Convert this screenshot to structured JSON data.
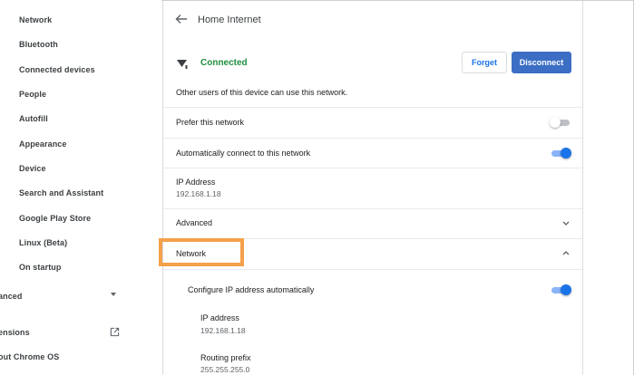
{
  "sidebar": {
    "items": [
      {
        "label": "Network"
      },
      {
        "label": "Bluetooth"
      },
      {
        "label": "Connected devices"
      },
      {
        "label": "People"
      },
      {
        "label": "Autofill"
      },
      {
        "label": "Appearance"
      },
      {
        "label": "Device"
      },
      {
        "label": "Search and Assistant"
      },
      {
        "label": "Google Play Store"
      },
      {
        "label": "Linux (Beta)"
      },
      {
        "label": "On startup"
      }
    ],
    "advanced_label": "anced",
    "extensions_label": "ensions",
    "about_label": "out Chrome OS"
  },
  "header": {
    "title": "Home Internet"
  },
  "connection": {
    "status": "Connected",
    "forget_label": "Forget",
    "disconnect_label": "Disconnect",
    "description": "Other users of this device can use this network."
  },
  "settings": {
    "prefer_label": "Prefer this network",
    "prefer_on": false,
    "auto_connect_label": "Automatically connect to this network",
    "auto_connect_on": true,
    "ip_address_label": "IP Address",
    "ip_address_value": "192.168.1.18",
    "advanced_label": "Advanced",
    "network_label": "Network"
  },
  "network_section": {
    "configure_label": "Configure IP address automatically",
    "configure_on": true,
    "ip_label": "IP address",
    "ip_value": "192.168.1.18",
    "prefix_label": "Routing prefix",
    "prefix_value": "255.255.255.0"
  },
  "colors": {
    "connected_green": "#1e8e3e",
    "primary_blue": "#3b6ec4",
    "highlight_orange": "#f5a04a"
  }
}
